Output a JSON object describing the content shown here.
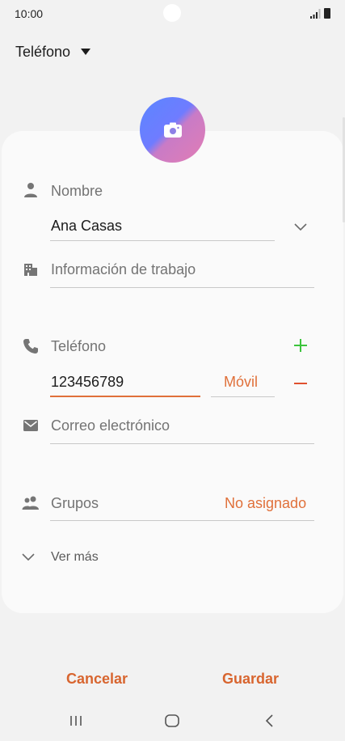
{
  "status_bar": {
    "time": "10:00"
  },
  "account": {
    "label": "Teléfono"
  },
  "form": {
    "name": {
      "placeholder": "Nombre",
      "value": "Ana Casas"
    },
    "work": {
      "placeholder": "Información de trabajo"
    },
    "phone": {
      "label": "Teléfono",
      "value": "123456789",
      "type": "Móvil"
    },
    "email": {
      "placeholder": "Correo electrónico"
    },
    "groups": {
      "label": "Grupos",
      "value": "No asignado"
    },
    "more": {
      "label": "Ver más"
    }
  },
  "actions": {
    "cancel": "Cancelar",
    "save": "Guardar"
  },
  "colors": {
    "accent": "#d8652f",
    "add": "#3cc43c",
    "remove": "#e0502f"
  },
  "icons": [
    "camera-icon",
    "person-icon",
    "building-icon",
    "phone-icon",
    "mail-icon",
    "people-icon",
    "chevron-down-icon",
    "plus-icon",
    "minus-icon"
  ]
}
